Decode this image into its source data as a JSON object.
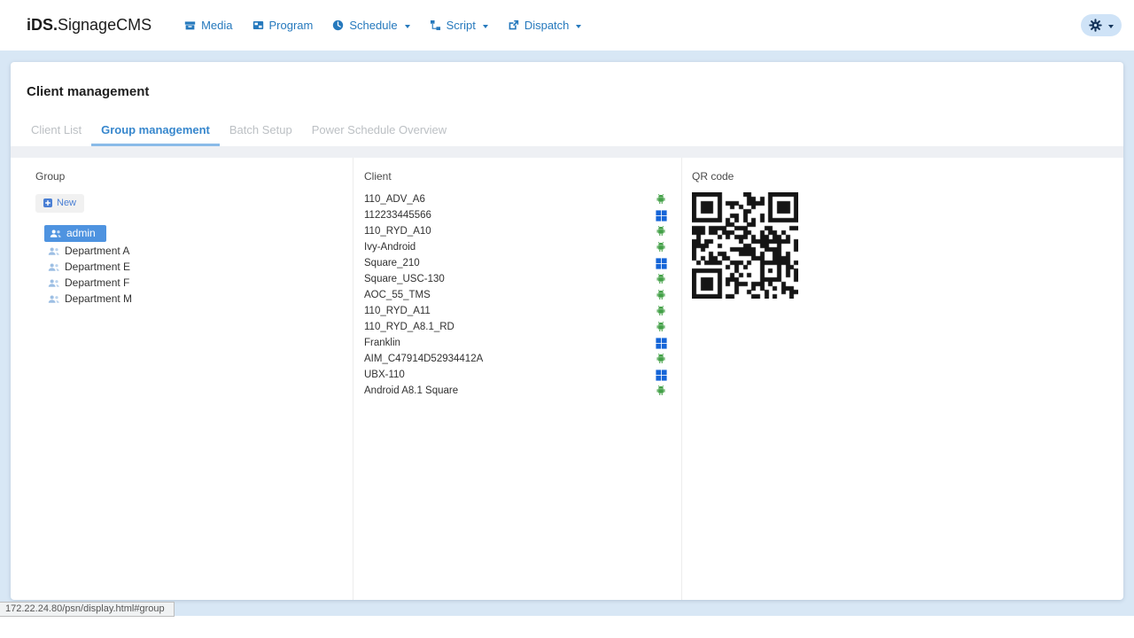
{
  "navbar": {
    "logo_bold": "iDS.",
    "logo_rest": "SignageCMS",
    "items": [
      {
        "label": "Media",
        "icon": "media-icon",
        "dropdown": false
      },
      {
        "label": "Program",
        "icon": "program-icon",
        "dropdown": false
      },
      {
        "label": "Schedule",
        "icon": "schedule-icon",
        "dropdown": true
      },
      {
        "label": "Script",
        "icon": "script-icon",
        "dropdown": true
      },
      {
        "label": "Dispatch",
        "icon": "dispatch-icon",
        "dropdown": true
      }
    ],
    "settings_icon": "gear-icon"
  },
  "page": {
    "title": "Client management"
  },
  "tabs": [
    {
      "label": "Client List",
      "active": false
    },
    {
      "label": "Group management",
      "active": true
    },
    {
      "label": "Batch Setup",
      "active": false
    },
    {
      "label": "Power Schedule Overview",
      "active": false
    }
  ],
  "group_panel": {
    "label": "Group",
    "new_button": "New",
    "groups": [
      {
        "name": "admin",
        "selected": true
      },
      {
        "name": "Department A",
        "selected": false
      },
      {
        "name": "Department E",
        "selected": false
      },
      {
        "name": "Department F",
        "selected": false
      },
      {
        "name": "Department M",
        "selected": false
      }
    ]
  },
  "client_panel": {
    "label": "Client",
    "clients": [
      {
        "name": "110_ADV_A6",
        "os": "android"
      },
      {
        "name": "112233445566",
        "os": "windows"
      },
      {
        "name": "110_RYD_A10",
        "os": "android"
      },
      {
        "name": "Ivy-Android",
        "os": "android"
      },
      {
        "name": "Square_210",
        "os": "windows"
      },
      {
        "name": "Square_USC-130",
        "os": "android"
      },
      {
        "name": "AOC_55_TMS",
        "os": "android"
      },
      {
        "name": "110_RYD_A11",
        "os": "android"
      },
      {
        "name": "110_RYD_A8.1_RD",
        "os": "android"
      },
      {
        "name": "Franklin",
        "os": "windows"
      },
      {
        "name": "AIM_C47914D52934412A",
        "os": "android"
      },
      {
        "name": "UBX-110",
        "os": "windows"
      },
      {
        "name": "Android A8.1 Square",
        "os": "android"
      }
    ]
  },
  "qr_panel": {
    "label": "QR code"
  },
  "statusbar": {
    "url": "172.22.24.80/psn/display.html#group"
  },
  "colors": {
    "nav_accent": "#2679bd",
    "active_tab": "#3787cd",
    "selected_group_bg": "#4e93e0",
    "android_green": "#43a047",
    "windows_blue": "#1565d8",
    "page_background": "#d8e7f5"
  }
}
